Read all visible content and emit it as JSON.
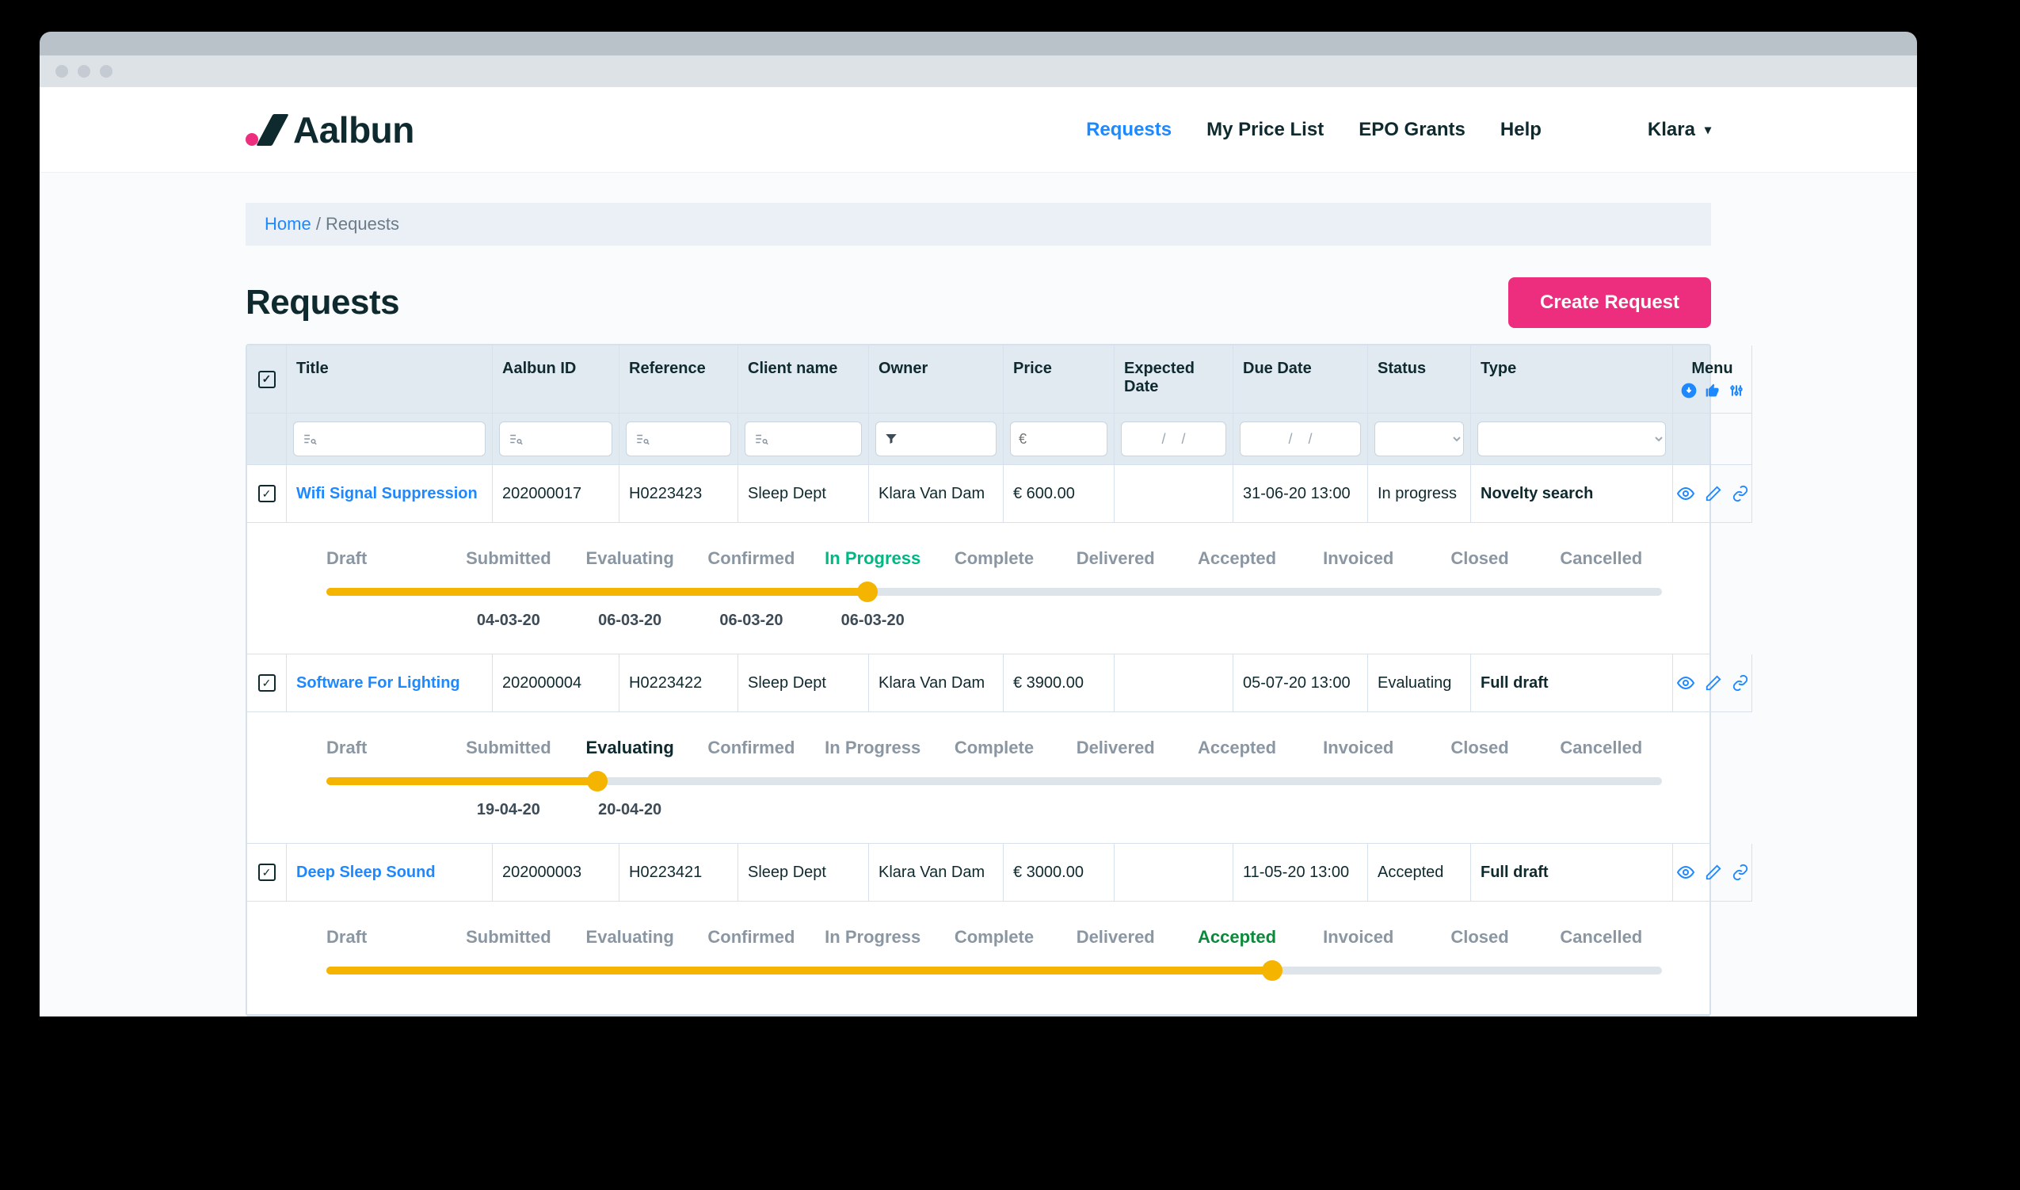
{
  "brand": "Aalbun",
  "nav": {
    "items": [
      "Requests",
      "My Price List",
      "EPO Grants",
      "Help"
    ],
    "activeIndex": 0,
    "user": "Klara"
  },
  "breadcrumb": {
    "home": "Home",
    "sep": "/",
    "current": "Requests"
  },
  "page": {
    "title": "Requests",
    "create_btn": "Create Request"
  },
  "columns": {
    "title": "Title",
    "aalbun_id": "Aalbun ID",
    "reference": "Reference",
    "client_name": "Client name",
    "owner": "Owner",
    "price": "Price",
    "expected_date": "Expected Date",
    "due_date": "Due Date",
    "status": "Status",
    "type": "Type",
    "menu": "Menu"
  },
  "filters": {
    "price_placeholder": "€",
    "date_placeholder": "/    /"
  },
  "stages": [
    "Draft",
    "Submitted",
    "Evaluating",
    "Confirmed",
    "In Progress",
    "Complete",
    "Delivered",
    "Accepted",
    "Invoiced",
    "Closed",
    "Cancelled"
  ],
  "rows": [
    {
      "title": "Wifi Signal Suppression",
      "aalbun_id": "202000017",
      "reference": "H0223423",
      "client_name": "Sleep Dept",
      "owner": "Klara Van Dam",
      "price": "€ 600.00",
      "expected_date": "",
      "due_date": "31-06-20 13:00",
      "status": "In progress",
      "status_key": "inprogress",
      "type": "Novelty search",
      "progress_percent": 40.5,
      "active_stage_index": 4,
      "dates": [
        "",
        "04-03-20",
        "06-03-20",
        "06-03-20",
        "06-03-20",
        "",
        "",
        "",
        "",
        "",
        ""
      ]
    },
    {
      "title": "Software For Lighting",
      "aalbun_id": "202000004",
      "reference": "H0223422",
      "client_name": "Sleep Dept",
      "owner": "Klara Van Dam",
      "price": "€ 3900.00",
      "expected_date": "",
      "due_date": "05-07-20 13:00",
      "status": "Evaluating",
      "status_key": "evaluating",
      "type": "Full draft",
      "progress_percent": 20.3,
      "active_stage_index": 2,
      "dates": [
        "",
        "19-04-20",
        "20-04-20",
        "",
        "",
        "",
        "",
        "",
        "",
        "",
        ""
      ]
    },
    {
      "title": "Deep Sleep Sound",
      "aalbun_id": "202000003",
      "reference": "H0223421",
      "client_name": "Sleep Dept",
      "owner": "Klara Van Dam",
      "price": "€ 3000.00",
      "expected_date": "",
      "due_date": "11-05-20 13:00",
      "status": "Accepted",
      "status_key": "accepted",
      "type": "Full draft",
      "progress_percent": 70.8,
      "active_stage_index": 7,
      "dates": [
        "",
        "",
        "",
        "",
        "",
        "",
        "",
        "",
        "",
        "",
        ""
      ]
    }
  ]
}
